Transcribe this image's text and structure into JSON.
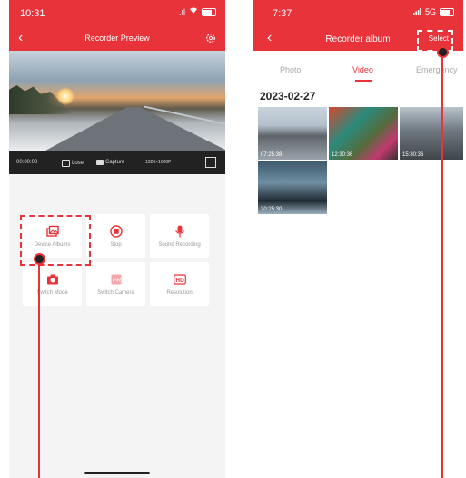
{
  "left_screen": {
    "status": {
      "time": "10:31",
      "signal": ".ıl"
    },
    "header": {
      "title": "Recorder Preview"
    },
    "video_bar": {
      "time": "00:00:00",
      "lose": "Lose",
      "capture": "Capture",
      "resolution": "1920×1080P"
    },
    "tiles": [
      {
        "label": "Device Albums",
        "icon": "album-icon"
      },
      {
        "label": "Stop",
        "icon": "stop-icon"
      },
      {
        "label": "Sound Recording",
        "icon": "microphone-icon"
      },
      {
        "label": "Switch Mode",
        "icon": "camera-icon"
      },
      {
        "label": "Switch Camera",
        "icon": "switch-camera-icon"
      },
      {
        "label": "Resolution",
        "icon": "hd-icon"
      }
    ]
  },
  "right_screen": {
    "status": {
      "time": "7:37",
      "network": "5G"
    },
    "header": {
      "title": "Recorder album",
      "select_label": "Select"
    },
    "tabs": [
      {
        "label": "Photo",
        "active": false
      },
      {
        "label": "Video",
        "active": true
      },
      {
        "label": "Emergency",
        "active": false
      }
    ],
    "date": "2023-02-27",
    "videos": [
      {
        "duration": "07:25:38"
      },
      {
        "duration": "12:30:36"
      },
      {
        "duration": "15:30:36"
      },
      {
        "duration": "20:25:30"
      }
    ]
  },
  "colors": {
    "accent": "#e8333a",
    "video_bar": "#222222"
  }
}
